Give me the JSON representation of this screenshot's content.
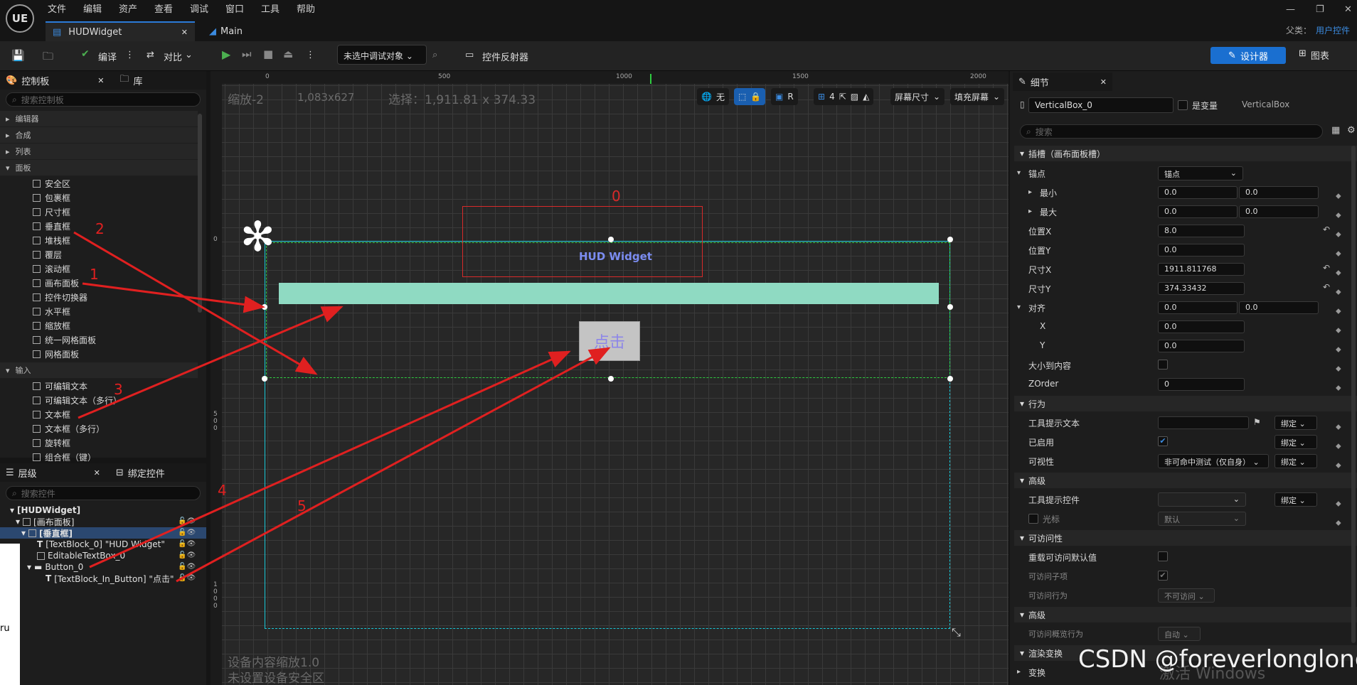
{
  "menu": [
    "文件",
    "编辑",
    "资产",
    "查看",
    "调试",
    "窗口",
    "工具",
    "帮助"
  ],
  "logo_text": "UE",
  "tabs": {
    "widget": "HUDWidget",
    "main": "Main"
  },
  "parent": {
    "label": "父类：",
    "value": "用户控件"
  },
  "toolbar": {
    "compile": "编译",
    "diff": "对比",
    "debug_target": "未选中调试对象",
    "reflector": "控件反射器",
    "designer": "设计器",
    "graph": "图表"
  },
  "palette": {
    "tab": "控制板",
    "lib_tab": "库",
    "search_placeholder": "搜索控制板",
    "categories": [
      "编辑器",
      "合成",
      "列表",
      "面板"
    ],
    "panel_items": [
      "安全区",
      "包裹框",
      "尺寸框",
      "垂直框",
      "堆栈框",
      "覆层",
      "滚动框",
      "画布面板",
      "控件切换器",
      "水平框",
      "缩放框",
      "统一网格面板",
      "网格面板"
    ],
    "input_category": "输入",
    "input_items": [
      "可编辑文本",
      "可编辑文本（多行）",
      "文本框",
      "文本框（多行）",
      "旋转框",
      "组合框（键）"
    ]
  },
  "hierarchy": {
    "tab": "层级",
    "bind_tab": "绑定控件",
    "search_placeholder": "搜索控件",
    "rows": [
      "[HUDWidget]",
      "[画布面板]",
      "[垂直框]",
      "[TextBlock_0] \"HUD Widget\"",
      "EditableTextBox_0",
      "Button_0",
      "[TextBlock_In_Button] \"点击\""
    ]
  },
  "canvas": {
    "zoom": "缩放-2",
    "size": "1,083x627",
    "selection": "选择：1,911.81 x 374.33",
    "ruler_h": [
      "0",
      "500",
      "1000",
      "1500",
      "2000"
    ],
    "ruler_v": [
      "0",
      "500",
      "1000"
    ],
    "tools": {
      "none": "无",
      "r": "R",
      "grid": "4",
      "screen": "屏幕尺寸",
      "fill": "填充屏幕"
    },
    "widget_title": "HUD Widget",
    "button_text": "点击",
    "device_scale": "设备内容缩放1.0",
    "safe_zone": "未设置设备安全区",
    "box_label": "0",
    "left_edge_text": "ru"
  },
  "annotations": [
    "0",
    "1",
    "2",
    "3",
    "4",
    "5"
  ],
  "details": {
    "tab": "细节",
    "name": "VerticalBox_0",
    "is_variable": "是变量",
    "class": "VerticalBox",
    "search_placeholder": "搜索",
    "slot_section": "插槽（画布面板槽）",
    "anchor_label": "锚点",
    "anchor_value": "锚点",
    "min_label": "最小",
    "min_x": "0.0",
    "min_y": "0.0",
    "max_label": "最大",
    "max_x": "0.0",
    "max_y": "0.0",
    "pos_x_label": "位置X",
    "pos_x": "8.0",
    "pos_y_label": "位置Y",
    "pos_y": "0.0",
    "size_x_label": "尺寸X",
    "size_x": "1911.811768",
    "size_y_label": "尺寸Y",
    "size_y": "374.33432",
    "align_label": "对齐",
    "align_a": "0.0",
    "align_b": "0.0",
    "x_label": "X",
    "x_value": "0.0",
    "y_label": "Y",
    "y_value": "0.0",
    "size_to_content": "大小到内容",
    "zorder_label": "ZOrder",
    "zorder": "0",
    "behavior": "行为",
    "tooltip_text": "工具提示文本",
    "enabled": "已启用",
    "visibility_label": "可视性",
    "visibility_value": "非可命中测试（仅自身）",
    "bind": "绑定",
    "advanced": "高级",
    "tooltip_widget": "工具提示控件",
    "cursor": "光标",
    "cursor_value": "默认",
    "accessibility": "可访问性",
    "override_access": "重载可访问默认值",
    "access_children": "可访问子项",
    "access_behavior": "可访问行为",
    "access_behavior_value": "不可访问",
    "advanced2": "高级",
    "access_summary": "可访问概览行为",
    "access_summary_value": "自动",
    "render_transform": "渲染变换",
    "transform": "变换"
  },
  "watermark": {
    "csdn": "CSDN @foreverlonglong",
    "activate": "激活 Windows"
  }
}
